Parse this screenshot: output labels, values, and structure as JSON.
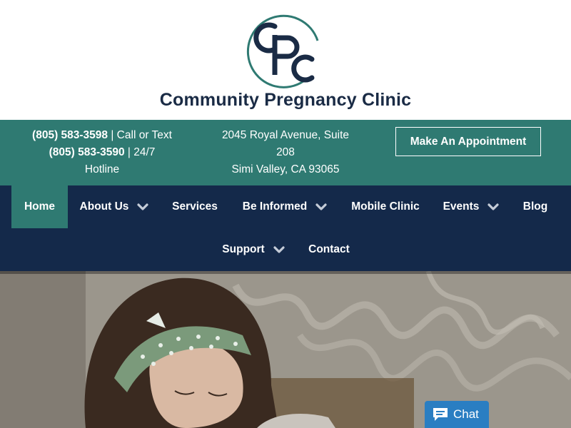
{
  "site": {
    "name": "Community Pregnancy Clinic",
    "logo_letters": "CPC"
  },
  "info_bar": {
    "phone_1": "(805) 583-3598",
    "phone_1_suffix": " | Call or Text",
    "phone_2": "(805) 583-3590",
    "phone_2_suffix": " | 24/7",
    "phone_2_line2": "Hotline",
    "address_line1": "2045 Royal Avenue, Suite",
    "address_line2": "208",
    "address_line3": "Simi Valley, CA 93065",
    "appointment_button": "Make An Appointment"
  },
  "nav": {
    "items": [
      {
        "label": "Home",
        "active": true,
        "dropdown": false
      },
      {
        "label": "About Us",
        "active": false,
        "dropdown": true
      },
      {
        "label": "Services",
        "active": false,
        "dropdown": false
      },
      {
        "label": "Be Informed",
        "active": false,
        "dropdown": true
      },
      {
        "label": "Mobile Clinic",
        "active": false,
        "dropdown": false
      },
      {
        "label": "Events",
        "active": false,
        "dropdown": true
      },
      {
        "label": "Blog",
        "active": false,
        "dropdown": false
      },
      {
        "label": "Support",
        "active": false,
        "dropdown": true
      },
      {
        "label": "Contact",
        "active": false,
        "dropdown": false
      }
    ]
  },
  "chat": {
    "label": "Chat",
    "icon": "chat-bubble-icon"
  },
  "colors": {
    "teal": "#2f7a72",
    "navy": "#14294a",
    "logo_dark": "#1a2b45",
    "chat_blue": "#2a7ec2"
  }
}
